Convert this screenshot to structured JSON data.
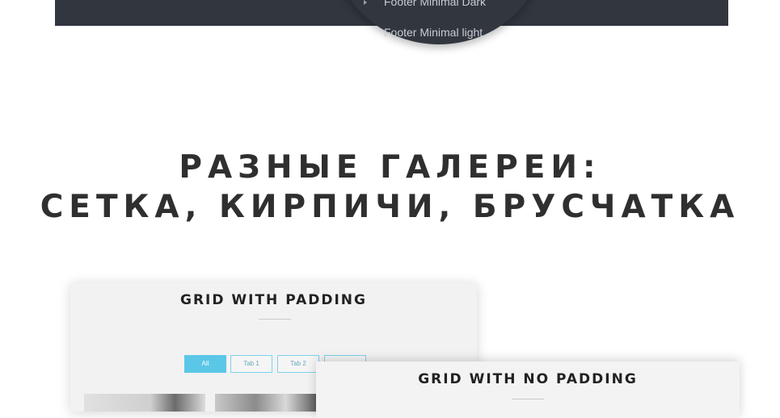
{
  "footer_menu": {
    "items": [
      "Footer Minimal Dark",
      "Footer Minimal light"
    ]
  },
  "heading": {
    "line1": "РАЗНЫЕ ГАЛЕРЕИ:",
    "line2": "СЕТКА, КИРПИЧИ, БРУСЧАТКА"
  },
  "cards": [
    {
      "title": "GRID WITH PADDING",
      "tabs": [
        "All",
        "Tab 1",
        "Tab 2",
        ""
      ]
    },
    {
      "title": "GRID WITH NO PADDING"
    }
  ],
  "colors": {
    "dark_bar": "#31363f",
    "tab_accent": "#5bc7e6",
    "heading_text": "#2f2f2f"
  }
}
